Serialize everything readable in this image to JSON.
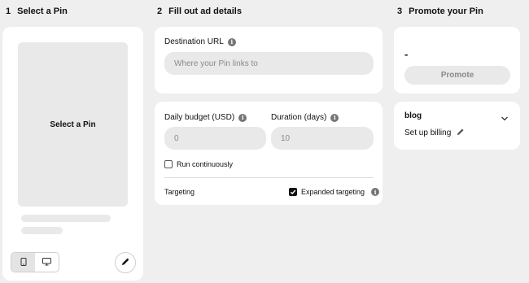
{
  "steps": [
    {
      "number": "1",
      "title": "Select a Pin"
    },
    {
      "number": "2",
      "title": "Fill out ad details"
    },
    {
      "number": "3",
      "title": "Promote your Pin"
    }
  ],
  "pin_panel": {
    "placeholder_label": "Select a Pin",
    "devices": [
      "mobile-icon",
      "desktop-icon"
    ],
    "active_device": "mobile"
  },
  "ad_details": {
    "destination_url": {
      "label": "Destination URL",
      "placeholder": "Where your Pin links to",
      "value": ""
    },
    "daily_budget": {
      "label": "Daily budget (USD)",
      "value": "0"
    },
    "duration": {
      "label": "Duration (days)",
      "value": "10"
    },
    "run_continuously": {
      "label": "Run continuously",
      "checked": false
    },
    "targeting": {
      "label": "Targeting"
    },
    "expanded_targeting": {
      "label": "Expanded targeting",
      "checked": true
    }
  },
  "promote": {
    "total": "-",
    "button_label": "Promote"
  },
  "billing": {
    "account_name": "blog",
    "setup_label": "Set up billing"
  },
  "colors": {
    "page_bg": "#efefef",
    "card_bg": "#ffffff",
    "input_bg": "#e9e9e9",
    "muted_text": "#8a8a8a"
  }
}
